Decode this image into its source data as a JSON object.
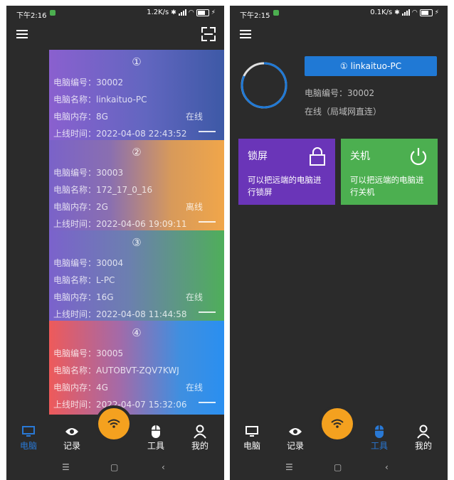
{
  "left": {
    "status": {
      "time": "下午2:16",
      "speed": "1.2K/s"
    },
    "cards": [
      {
        "index": "①",
        "number_label": "电脑编号：",
        "number": "30002",
        "name_label": "电脑名称：",
        "name": "linkaituo-PC",
        "memory_label": "电脑内存：",
        "memory": "8G",
        "state": "在线",
        "online_label": "上线时间：",
        "online": "2022-04-08 22:43:52"
      },
      {
        "index": "②",
        "number_label": "电脑编号：",
        "number": "30003",
        "name_label": "电脑名称：",
        "name": "172_17_0_16",
        "memory_label": "电脑内存：",
        "memory": "2G",
        "state": "离线",
        "online_label": "上线时间：",
        "online": "2022-04-06 19:09:11"
      },
      {
        "index": "③",
        "number_label": "电脑编号：",
        "number": "30004",
        "name_label": "电脑名称：",
        "name": "L-PC",
        "memory_label": "电脑内存：",
        "memory": "16G",
        "state": "在线",
        "online_label": "上线时间：",
        "online": "2022-04-08 11:44:58"
      },
      {
        "index": "④",
        "number_label": "电脑编号：",
        "number": "30005",
        "name_label": "电脑名称：",
        "name": "AUTOBVT-ZQV7KWJ",
        "memory_label": "电脑内存：",
        "memory": "4G",
        "state": "在线",
        "online_label": "上线时间：",
        "online": "2022-04-07 15:32:06"
      }
    ],
    "active_tab": "电脑"
  },
  "right": {
    "status": {
      "time": "下午2:15",
      "speed": "0.1K/s"
    },
    "device_button": "linkaituo-PC",
    "device_index": "①",
    "number_line": "电脑编号：30002",
    "state_line": "在线（局域网直连）",
    "lock_tile": {
      "title": "锁屏",
      "desc": "可以把远端的电脑进行锁屏"
    },
    "shutdown_tile": {
      "title": "关机",
      "desc": "可以把远端的电脑进行关机"
    },
    "active_tab": "工具"
  },
  "nav": {
    "computer": "电脑",
    "records": "记录",
    "tools": "工具",
    "mine": "我的"
  },
  "colors": {
    "accent": "#2079d5",
    "fab": "#f4a11f",
    "lock_tile": "#6a35b8",
    "shutdown_tile": "#4caf50",
    "background": "#2b2b2b"
  }
}
